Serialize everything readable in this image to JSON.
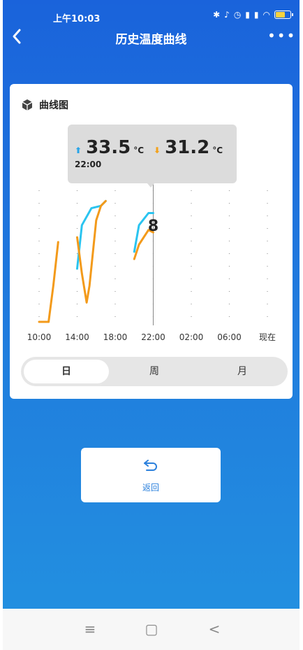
{
  "status_bar": {
    "time": "上午10:03",
    "icons": [
      "bluetooth-icon",
      "alarm-off-icon",
      "alarm-icon",
      "hd-signal-icon",
      "signal-icon",
      "wifi-icon",
      "battery-icon"
    ]
  },
  "nav": {
    "back_icon": "chevron-left-icon",
    "title": "历史温度曲线",
    "more_icon": "more-dots-icon",
    "more_label": "•••"
  },
  "card": {
    "title": "曲线图",
    "title_icon": "cube-icon",
    "tooltip": {
      "max_value": "33.5",
      "max_unit": "°C",
      "min_value": "31.2",
      "min_unit": "°C",
      "time": "22:00",
      "up_arrow": "⬆",
      "down_arrow": "⬇"
    },
    "segments": [
      {
        "label": "日",
        "active": true
      },
      {
        "label": "周",
        "active": false
      },
      {
        "label": "月",
        "active": false
      }
    ]
  },
  "chart_data": {
    "type": "line",
    "x_ticks": [
      "10:00",
      "14:00",
      "18:00",
      "22:00",
      "02:00",
      "06:00",
      "现在"
    ],
    "cursor_label": "8",
    "cursor_at": "22:00",
    "ylim": [
      29,
      34.5
    ],
    "series": [
      {
        "color": "#2ac4f0",
        "segments": [
          [
            [
              14.0,
              31.2
            ],
            [
              14.5,
              33.0
            ],
            [
              15.5,
              33.7
            ],
            [
              16.5,
              33.8
            ],
            [
              17.0,
              34.0
            ]
          ],
          [
            [
              20.0,
              31.9
            ],
            [
              20.5,
              33.0
            ],
            [
              21.5,
              33.5
            ],
            [
              22.0,
              33.5
            ]
          ]
        ]
      },
      {
        "color": "#f39a1a",
        "segments": [
          [
            [
              10.0,
              29.0
            ],
            [
              11.0,
              29.0
            ],
            [
              11.5,
              30.5
            ],
            [
              12.0,
              32.3
            ]
          ],
          [
            [
              14.0,
              32.5
            ],
            [
              14.5,
              31.0
            ],
            [
              15.0,
              29.8
            ],
            [
              15.3,
              30.5
            ],
            [
              16.0,
              33.2
            ],
            [
              16.5,
              33.8
            ],
            [
              17.0,
              34.0
            ]
          ],
          [
            [
              20.0,
              31.6
            ],
            [
              20.5,
              32.2
            ],
            [
              21.5,
              32.8
            ],
            [
              22.0,
              32.7
            ]
          ]
        ]
      }
    ],
    "grid": "dotted",
    "legend": "none"
  },
  "return_button": {
    "icon": "undo-icon",
    "label": "返回"
  },
  "system_nav": {
    "menu": "≡",
    "home": "▢",
    "back": "<"
  }
}
